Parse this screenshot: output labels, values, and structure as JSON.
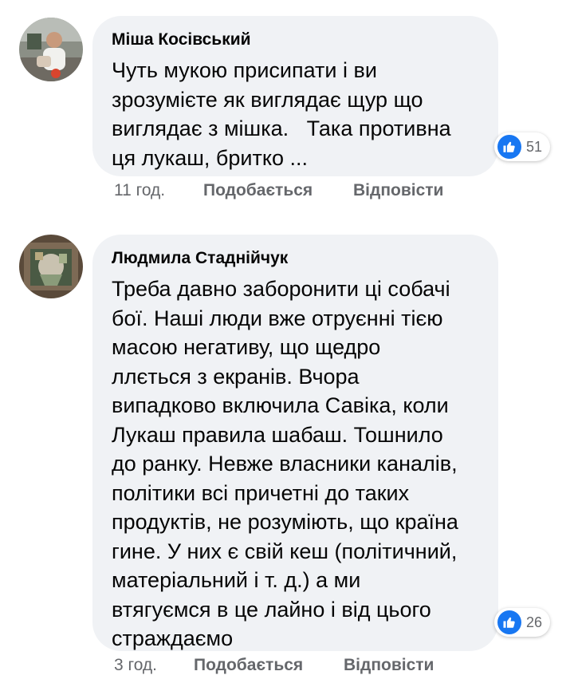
{
  "comments": [
    {
      "author": "Міша Косівський",
      "text": "Чуть мукою присипати і ви\nзрозумієте як виглядає щур що\nвиглядає з мішка.   Така противна\nця лукаш, бритко ...",
      "reaction_count": "51",
      "time": "11 год.",
      "like_label": "Подобається",
      "reply_label": "Відповісти"
    },
    {
      "author": "Людмила Стаднійчук",
      "text": "Треба давно заборонити ці собачі\nбої. Наші люди вже отруєнні тією\nмасою негативу, що щедро\nллється з екранів. Вчора\nвипадково включила Савіка, коли\nЛукаш правила шабаш. Тошнило\nдо ранку. Невже власники каналів,\nполітики всі причетні до таких\nпродуктів, не розуміють, що країна\nгине. У них є свій кеш (політичний,\nматеріальний і т. д.) а ми\nвтягуємся в це лайно і від цього\nстраждаємо",
      "reaction_count": "26",
      "time": "3 год.",
      "like_label": "Подобається",
      "reply_label": "Відповісти"
    }
  ],
  "icons": {
    "reaction": "like-thumbs-up-icon"
  },
  "colors": {
    "bubble": "#f0f2f5",
    "like_blue": "#1877f2",
    "meta_gray": "#65676b"
  }
}
